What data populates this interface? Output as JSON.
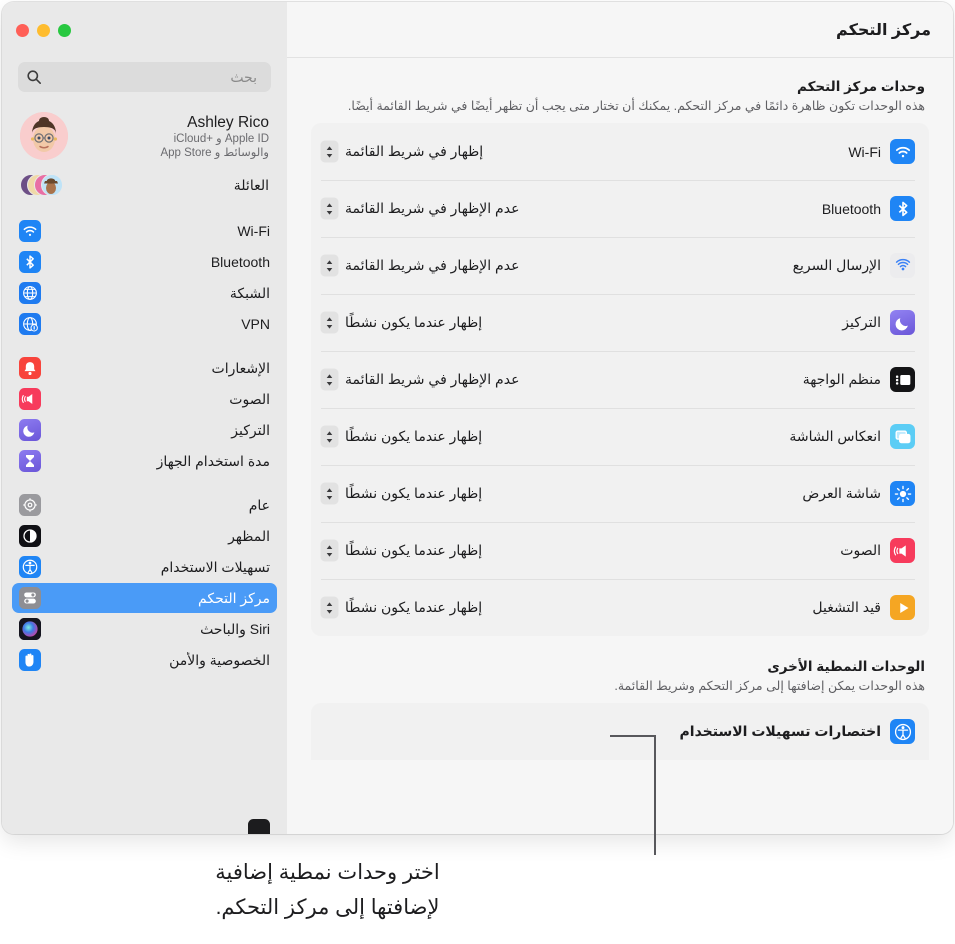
{
  "window": {
    "title": "مركز التحكم",
    "traffic_lights": [
      {
        "name": "close",
        "color": "#ff5f57"
      },
      {
        "name": "minimize",
        "color": "#febc2e"
      },
      {
        "name": "zoom",
        "color": "#28c840"
      }
    ]
  },
  "sidebar": {
    "search": {
      "placeholder": "بحث",
      "value": ""
    },
    "account": {
      "name": "Ashley Rico",
      "subtitle_line1": "Apple ID و +iCloud",
      "subtitle_line2": "والوسائط و App Store"
    },
    "family": {
      "label": "العائلة"
    },
    "groups": [
      {
        "items": [
          {
            "label": "Wi-Fi",
            "icon": "wifi-icon",
            "selected": false
          },
          {
            "label": "Bluetooth",
            "icon": "bluetooth-icon",
            "selected": false
          },
          {
            "label": "الشبكة",
            "icon": "network-globe-icon",
            "selected": false
          },
          {
            "label": "VPN",
            "icon": "vpn-globe-icon",
            "selected": false
          }
        ]
      },
      {
        "items": [
          {
            "label": "الإشعارات",
            "icon": "notifications-bell-icon",
            "selected": false
          },
          {
            "label": "الصوت",
            "icon": "sound-speaker-icon",
            "selected": false
          },
          {
            "label": "التركيز",
            "icon": "focus-moon-icon",
            "selected": false
          },
          {
            "label": "مدة استخدام الجهاز",
            "icon": "screen-time-hourglass-icon",
            "selected": false
          }
        ]
      },
      {
        "items": [
          {
            "label": "عام",
            "icon": "general-gear-icon",
            "selected": false
          },
          {
            "label": "المظهر",
            "icon": "appearance-contrast-icon",
            "selected": false
          },
          {
            "label": "تسهيلات الاستخدام",
            "icon": "accessibility-icon",
            "selected": false
          },
          {
            "label": "مركز التحكم",
            "icon": "control-center-icon",
            "selected": true
          },
          {
            "label": "Siri والباحث",
            "icon": "siri-icon",
            "selected": false
          },
          {
            "label": "الخصوصية والأمن",
            "icon": "privacy-hand-icon",
            "selected": false
          }
        ]
      }
    ],
    "selection_color": "#4a9bf7"
  },
  "main": {
    "modules_section": {
      "title": "وحدات مركز التحكم",
      "description": "هذه الوحدات تكون ظاهرة دائمًا في مركز التحكم. يمكنك أن تختار متى يجب أن تظهر أيضًا في شريط القائمة أيضًا."
    },
    "modules": [
      {
        "name": "Wi-Fi",
        "icon": "wifi-icon",
        "value": "إظهار في شريط القائمة"
      },
      {
        "name": "Bluetooth",
        "icon": "bluetooth-icon",
        "value": "عدم الإظهار في شريط القائمة"
      },
      {
        "name": "الإرسال السريع",
        "icon": "airdrop-icon",
        "value": "عدم الإظهار في شريط القائمة"
      },
      {
        "name": "التركيز",
        "icon": "focus-moon-icon",
        "value": "إظهار عندما يكون نشطًا"
      },
      {
        "name": "منظم الواجهة",
        "icon": "stage-manager-icon",
        "value": "عدم الإظهار في شريط القائمة"
      },
      {
        "name": "انعكاس الشاشة",
        "icon": "screen-mirroring-icon",
        "value": "إظهار عندما يكون نشطًا"
      },
      {
        "name": "شاشة العرض",
        "icon": "display-brightness-icon",
        "value": "إظهار عندما يكون نشطًا"
      },
      {
        "name": "الصوت",
        "icon": "sound-speaker-icon",
        "value": "إظهار عندما يكون نشطًا"
      },
      {
        "name": "قيد التشغيل",
        "icon": "now-playing-icon",
        "value": "إظهار عندما يكون نشطًا"
      }
    ],
    "other_section": {
      "title": "الوحدات النمطية الأخرى",
      "description": "هذه الوحدات يمكن إضافتها إلى مركز التحكم وشريط القائمة."
    },
    "other_modules": [
      {
        "name": "اختصارات تسهيلات الاستخدام",
        "icon": "accessibility-icon"
      }
    ]
  },
  "callout": {
    "line1": "اختر وحدات نمطية إضافية",
    "line2": "لإضافتها إلى مركز التحكم."
  }
}
